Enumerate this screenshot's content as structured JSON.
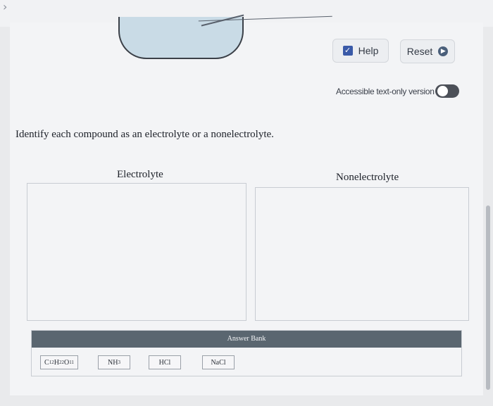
{
  "nav": {
    "arrow": "›"
  },
  "toolbar": {
    "help_label": "Help",
    "reset_label": "Reset"
  },
  "accessibility": {
    "label": "Accessible text-only version"
  },
  "question": {
    "text": "Identify each compound as an electrolyte or a nonelectrolyte."
  },
  "bins": {
    "electrolyte": "Electrolyte",
    "nonelectrolyte": "Nonelectrolyte"
  },
  "answer_bank": {
    "title": "Answer Bank",
    "chips": [
      {
        "base": "C",
        "s1": "12",
        "b2": "H",
        "s2": "22",
        "b3": "O",
        "s3": "11"
      },
      {
        "base": "NH",
        "s1": "3"
      },
      {
        "base": "HCl"
      },
      {
        "base": "NaCl"
      }
    ]
  },
  "colors": {
    "header": "#5a6670",
    "beaker_liquid": "#c9dbe6",
    "help_check": "#3a5aa8"
  }
}
